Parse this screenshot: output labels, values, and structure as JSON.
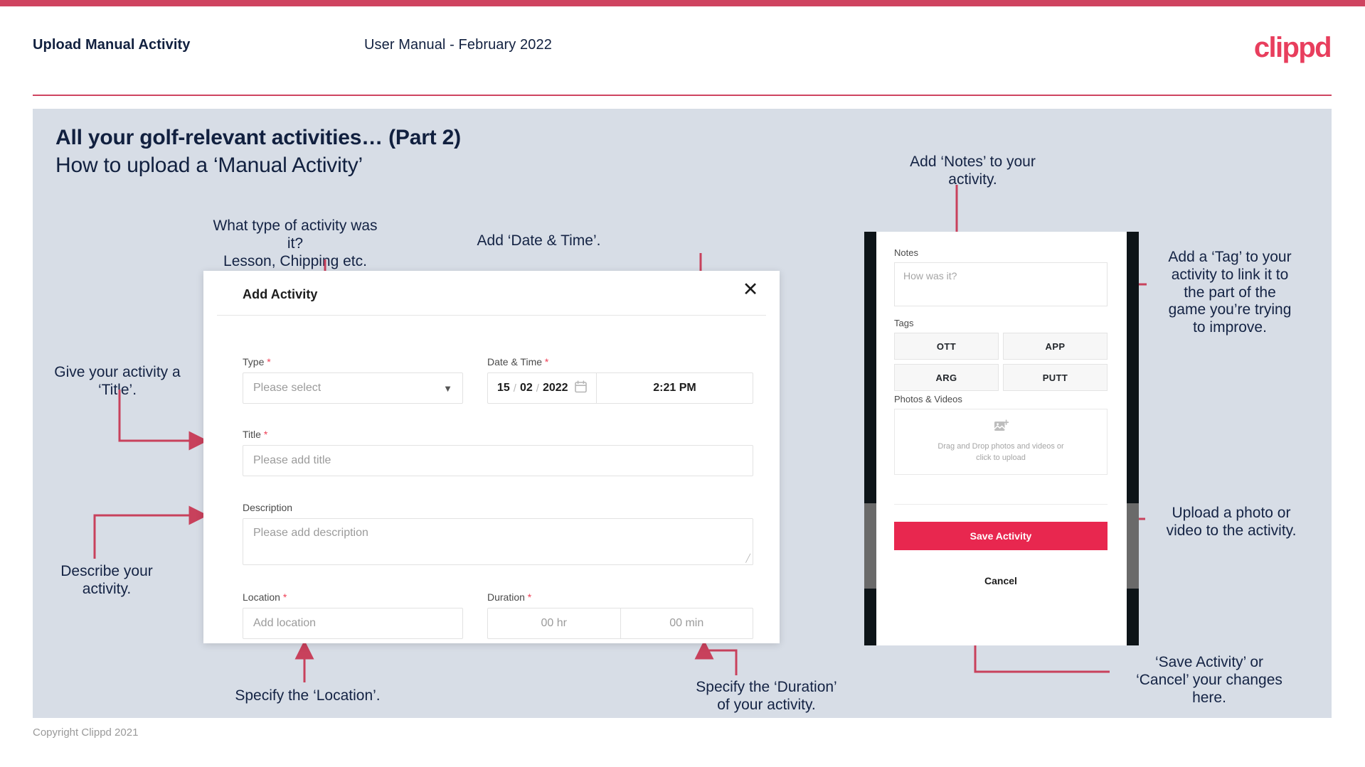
{
  "header": {
    "title": "Upload Manual Activity",
    "subtitle": "User Manual - February 2022",
    "logo": "clippd"
  },
  "slide": {
    "title": "All your golf-relevant activities… (Part 2)",
    "subtitle": "How to upload a ‘Manual Activity’"
  },
  "annotations": {
    "type": "What type of activity was it?\nLesson, Chipping etc.",
    "datetime": "Add ‘Date & Time’.",
    "title": "Give your activity a\n‘Title’.",
    "description": "Describe your\nactivity.",
    "location": "Specify the ‘Location’.",
    "duration": "Specify the ‘Duration’\nof your activity.",
    "notes": "Add ‘Notes’ to your\nactivity.",
    "tags": "Add a ‘Tag’ to your\nactivity to link it to\nthe part of the\ngame you’re trying\nto improve.",
    "upload": "Upload a photo or\nvideo to the activity.",
    "save": "‘Save Activity’ or\n‘Cancel’ your changes\nhere."
  },
  "modal": {
    "title": "Add Activity",
    "close_icon": "close-icon",
    "fields": {
      "type": {
        "label": "Type",
        "required": true,
        "placeholder": "Please select",
        "icon": "chevron-down-icon"
      },
      "datetime": {
        "label": "Date & Time",
        "required": true,
        "day": "15",
        "month": "02",
        "year": "2022",
        "separator": "/",
        "icon": "calendar-icon",
        "time": "2:21 PM"
      },
      "title": {
        "label": "Title",
        "required": true,
        "placeholder": "Please add title"
      },
      "description": {
        "label": "Description",
        "required": false,
        "placeholder": "Please add description"
      },
      "location": {
        "label": "Location",
        "required": true,
        "placeholder": "Add location"
      },
      "duration": {
        "label": "Duration",
        "required": true,
        "hours": "00 hr",
        "minutes": "00 min"
      }
    }
  },
  "phone": {
    "notes": {
      "label": "Notes",
      "placeholder": "How was it?"
    },
    "tags": {
      "label": "Tags",
      "options": [
        "OTT",
        "APP",
        "ARG",
        "PUTT"
      ]
    },
    "media": {
      "label": "Photos & Videos",
      "icon": "add-image-icon",
      "hint_line1": "Drag and Drop photos and videos or",
      "hint_line2": "click to upload"
    },
    "save_label": "Save Activity",
    "cancel_label": "Cancel"
  },
  "footer": {
    "copyright": "Copyright Clippd 2021"
  },
  "colors": {
    "brand_pink": "#e83e5d",
    "top_bar": "#cf4460",
    "slide_bg": "#d7dde6",
    "arrow": "#c8415c",
    "save_button": "#e8274f",
    "text_dark": "#11203f"
  }
}
